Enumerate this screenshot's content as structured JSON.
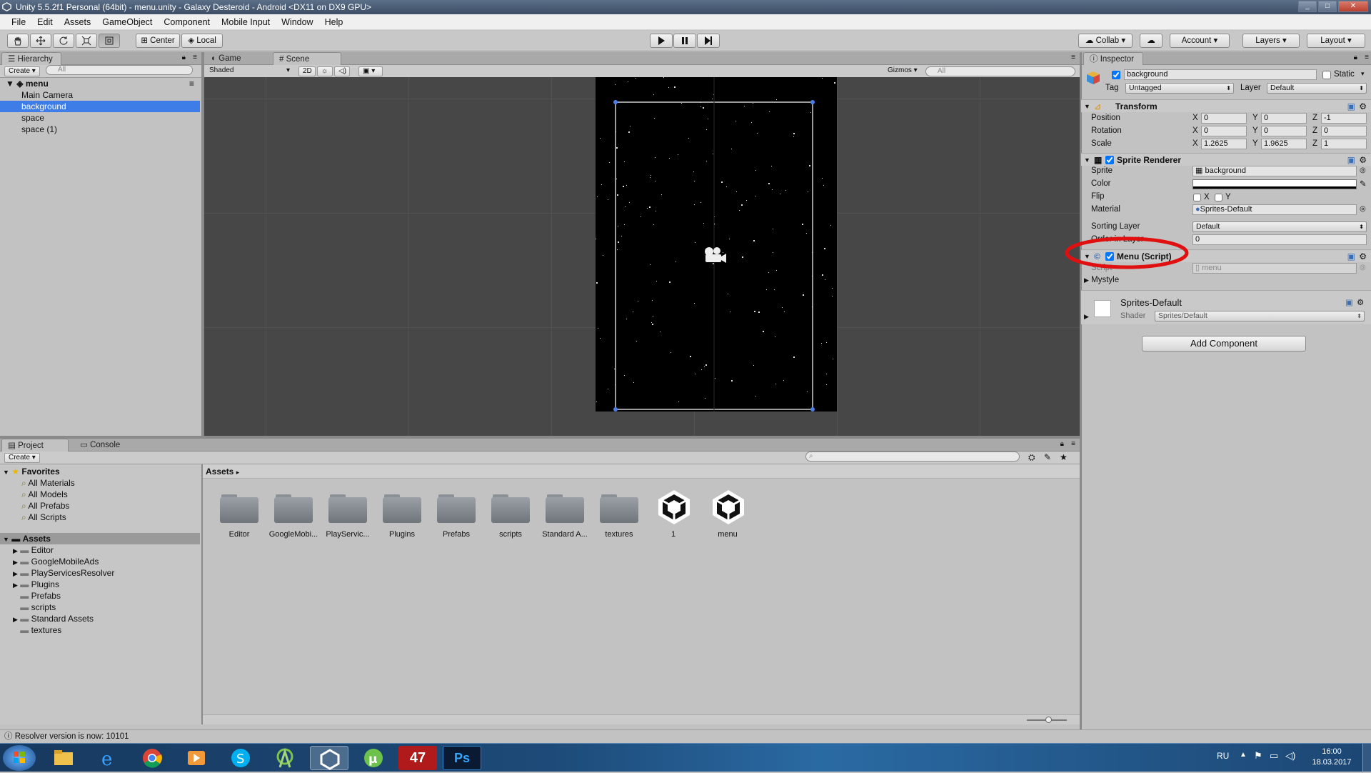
{
  "window": {
    "title": "Unity 5.5.2f1 Personal (64bit) - menu.unity - Galaxy Desteroid - Android <DX11 on DX9 GPU>"
  },
  "menubar": [
    "File",
    "Edit",
    "Assets",
    "GameObject",
    "Component",
    "Mobile Input",
    "Window",
    "Help"
  ],
  "toolbar": {
    "center_label": "Center",
    "local_label": "Local",
    "collab_label": "Collab",
    "account_label": "Account",
    "layers_label": "Layers",
    "layout_label": "Layout"
  },
  "hierarchy": {
    "tab": "Hierarchy",
    "create": "Create",
    "search_placeholder": "All",
    "scene": "menu",
    "items": [
      "Main Camera",
      "background",
      "space",
      "space (1)"
    ]
  },
  "scene": {
    "tab_game": "Game",
    "tab_scene": "Scene",
    "shading": "Shaded",
    "mode_2d": "2D",
    "gizmos": "Gizmos",
    "search_placeholder": "All"
  },
  "inspector": {
    "tab": "Inspector",
    "object_name": "background",
    "static_label": "Static",
    "tag_label": "Tag",
    "tag_value": "Untagged",
    "layer_label": "Layer",
    "layer_value": "Default",
    "transform": {
      "title": "Transform",
      "position": {
        "label": "Position",
        "x": "0",
        "y": "0",
        "z": "-1"
      },
      "rotation": {
        "label": "Rotation",
        "x": "0",
        "y": "0",
        "z": "0"
      },
      "scale": {
        "label": "Scale",
        "x": "1.2625",
        "y": "1.9625",
        "z": "1"
      }
    },
    "sprite_renderer": {
      "title": "Sprite Renderer",
      "sprite_label": "Sprite",
      "sprite_value": "background",
      "color_label": "Color",
      "flip_label": "Flip",
      "flip_x": "X",
      "flip_y": "Y",
      "material_label": "Material",
      "material_value": "Sprites-Default",
      "sorting_layer_label": "Sorting Layer",
      "sorting_layer_value": "Default",
      "order_label": "Order in Layer",
      "order_value": "0"
    },
    "menu_script": {
      "title": "Menu (Script)",
      "script_label": "Script",
      "script_value": "menu"
    },
    "mystyle": "Mystyle",
    "material": {
      "name": "Sprites-Default",
      "shader_label": "Shader",
      "shader_value": "Sprites/Default"
    },
    "add_component": "Add Component"
  },
  "project": {
    "tab_project": "Project",
    "tab_console": "Console",
    "create": "Create",
    "favorites_label": "Favorites",
    "favorites": [
      "All Materials",
      "All Models",
      "All Prefabs",
      "All Scripts"
    ],
    "assets_label": "Assets",
    "tree": [
      "Editor",
      "GoogleMobileAds",
      "PlayServicesResolver",
      "Plugins",
      "Prefabs",
      "scripts",
      "Standard Assets",
      "textures"
    ],
    "breadcrumb": "Assets",
    "grid": [
      {
        "label": "Editor",
        "kind": "folder"
      },
      {
        "label": "GoogleMobi...",
        "kind": "folder"
      },
      {
        "label": "PlayServic...",
        "kind": "folder"
      },
      {
        "label": "Plugins",
        "kind": "folder"
      },
      {
        "label": "Prefabs",
        "kind": "folder"
      },
      {
        "label": "scripts",
        "kind": "folder"
      },
      {
        "label": "Standard A...",
        "kind": "folder"
      },
      {
        "label": "textures",
        "kind": "folder"
      },
      {
        "label": "1",
        "kind": "unity"
      },
      {
        "label": "menu",
        "kind": "unity"
      }
    ]
  },
  "statusbar": {
    "text": "Resolver version is now: 10101"
  },
  "taskbar": {
    "lang": "RU",
    "time": "16:00",
    "date": "18.03.2017",
    "app_47": "47",
    "app_ps": "Ps"
  }
}
